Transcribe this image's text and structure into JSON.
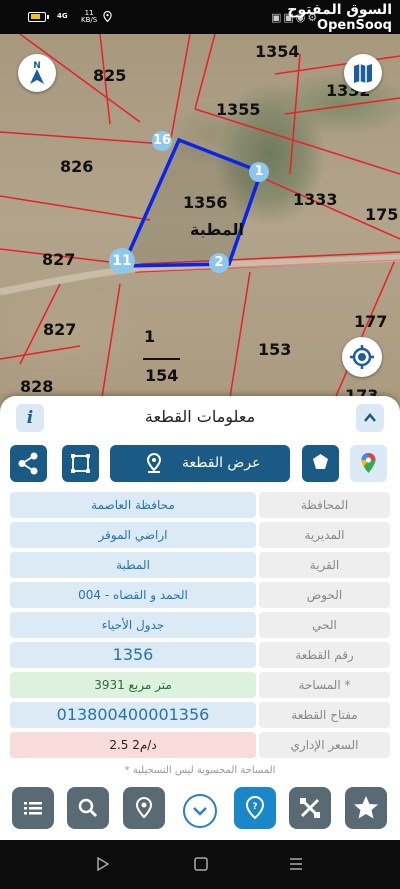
{
  "status_bar": {
    "signal_label": "4G",
    "net_speed_value": "11",
    "net_speed_unit": "KB/S",
    "brand_arabic": "السوق المفتوح",
    "brand_english": "OpenSooq"
  },
  "map": {
    "parcel_labels": [
      "1354",
      "825",
      "1355",
      "1332",
      "826",
      "1356",
      "1333",
      "175",
      "827",
      "827",
      "1",
      "177",
      "153",
      "154",
      "828",
      "173"
    ],
    "parcel_name": "المطبة",
    "vertices": [
      "16",
      "1",
      "2",
      "11"
    ],
    "colors": {
      "boundary": "#0a24e8",
      "parcel_lines": "#e8202a",
      "vertex": "#8ec7ee"
    }
  },
  "panel": {
    "title": "معلومات القطعة",
    "info_label": "i",
    "show_parcel_label": "عرض القطعة",
    "rows": [
      {
        "label": "المحافظة",
        "value": "محافظة العاصمة"
      },
      {
        "label": "المديرية",
        "value": "اراضي الموقر"
      },
      {
        "label": "القرية",
        "value": "المطبة"
      },
      {
        "label": "الحوض",
        "value": "الحمد و القضاه - 004"
      },
      {
        "label": "الحي",
        "value": "جدول الأحياء"
      },
      {
        "label": "رقم القطعة",
        "value": "1356"
      },
      {
        "label": "المساحة *",
        "value": "3931  متر مربع"
      },
      {
        "label": "مفتاح القطعة",
        "value": "013800400001356"
      },
      {
        "label": "السعر الإداري",
        "value": "2.5 د/م2"
      }
    ],
    "footnote": "* المساحة المحسوبة ليس التسجيلية"
  },
  "icons": [
    "share-icon",
    "crop-icon",
    "location-pin-icon",
    "star-icon",
    "google-maps-icon",
    "menu-list-icon",
    "search-icon",
    "location-icon",
    "chevron-down-icon",
    "help-pin-icon",
    "tools-icon",
    "favorite-star-icon",
    "compass-icon",
    "map-view-icon",
    "locate-icon"
  ]
}
